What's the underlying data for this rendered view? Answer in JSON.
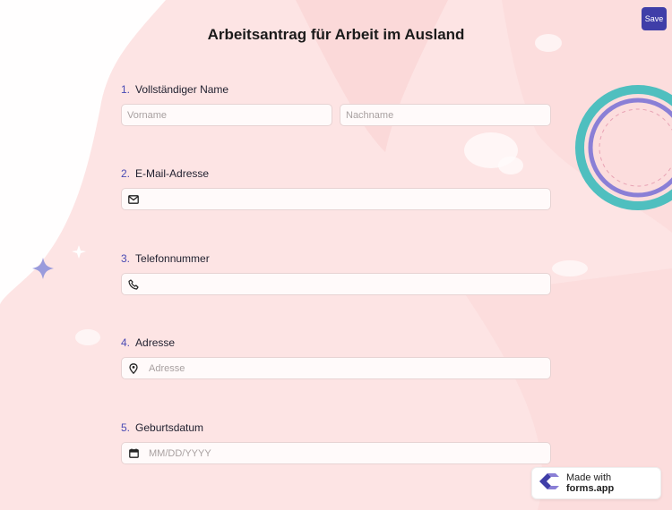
{
  "header": {
    "title": "Arbeitsantrag für Arbeit im Ausland",
    "save_label": "Save"
  },
  "questions": [
    {
      "number": "1.",
      "label": "Vollständiger Name",
      "first_placeholder": "Vorname",
      "last_placeholder": "Nachname"
    },
    {
      "number": "2.",
      "label": "E-Mail-Adresse",
      "placeholder": ""
    },
    {
      "number": "3.",
      "label": "Telefonnummer",
      "placeholder": ""
    },
    {
      "number": "4.",
      "label": "Adresse",
      "placeholder": "Adresse"
    },
    {
      "number": "5.",
      "label": "Geburtsdatum",
      "placeholder": "MM/DD/YYYY"
    }
  ],
  "badge": {
    "prefix": "Made with",
    "brand": "forms.app"
  },
  "icons": {
    "email": "envelope-icon",
    "phone": "phone-icon",
    "address": "location-pin-icon",
    "date": "calendar-icon",
    "logo": "forms-app-logo-icon"
  },
  "colors": {
    "accent": "#3f3ea8",
    "background": "#fde4e4",
    "ring_teal": "#4fbfbf",
    "ring_purple": "#8a7fd6"
  }
}
